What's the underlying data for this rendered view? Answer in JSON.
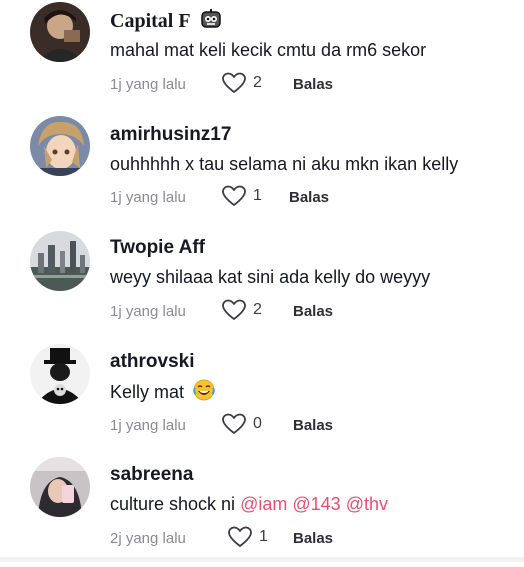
{
  "comments": [
    {
      "username": "Capital F",
      "text": "mahal mat keli kecik cmtu da rm6 sekor",
      "time": "1j yang lalu",
      "likes": "2",
      "reply_label": "Balas",
      "avatar_icon": "user-photo-avatar"
    },
    {
      "username": "amirhusinz17",
      "text": "ouhhhhh x tau selama ni aku mkn ikan kelly",
      "time": "1j yang lalu",
      "likes": "1",
      "reply_label": "Balas",
      "avatar_icon": "anime-avatar"
    },
    {
      "username": "Twopie Aff",
      "text": "weyy shilaaa kat sini ada kelly do weyyy",
      "time": "1j yang lalu",
      "likes": "2",
      "reply_label": "Balas",
      "avatar_icon": "city-skyline-avatar"
    },
    {
      "username": "athrovski",
      "text": "Kelly mat",
      "time": "1j yang lalu",
      "likes": "0",
      "reply_label": "Balas",
      "avatar_icon": "skull-hat-avatar"
    },
    {
      "username": "sabreena",
      "text": "culture shock ni",
      "mentions": [
        "@iam",
        "@143",
        "@thv"
      ],
      "time": "2j yang lalu",
      "likes": "1",
      "reply_label": "Balas",
      "avatar_icon": "selfie-avatar"
    }
  ],
  "colors": {
    "mention": "#e8506c",
    "meta": "#8a8b91",
    "text": "#161823"
  }
}
